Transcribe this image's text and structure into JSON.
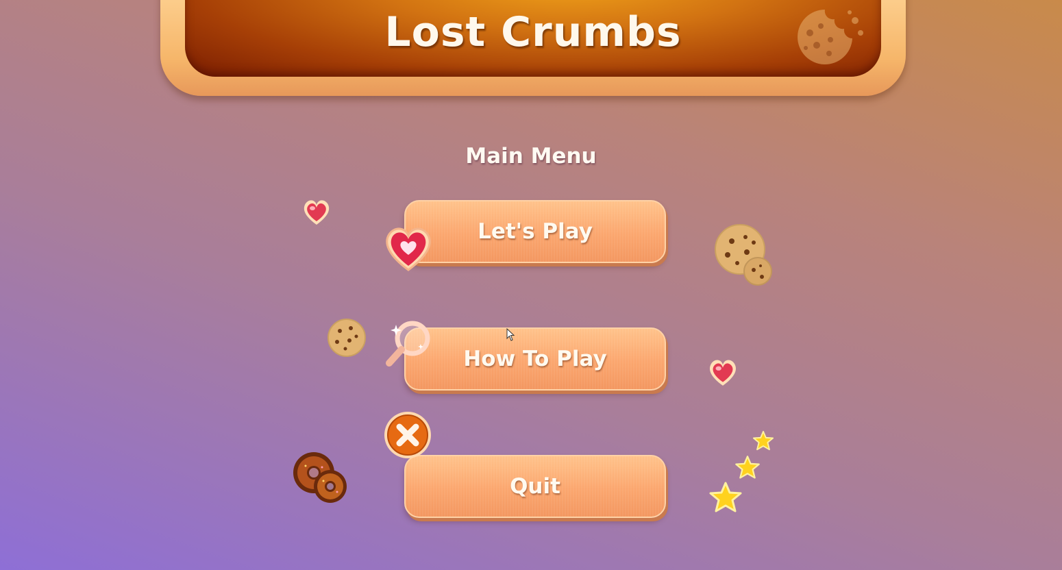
{
  "title": "Lost Crumbs",
  "menu": {
    "heading": "Main Menu",
    "buttons": [
      {
        "label": "Let's Play",
        "icon": "heart-icon"
      },
      {
        "label": "How To Play",
        "icon": "magnifier-icon"
      },
      {
        "label": "Quit",
        "icon": "close-icon"
      }
    ]
  },
  "decorations": [
    "cookie-icon",
    "heart-icon",
    "donut-icon",
    "star-icon"
  ],
  "colors": {
    "banner_dark": "#7a1d02",
    "banner_light": "#f0a21a",
    "button": "#fba66e",
    "text": "#fffaf2"
  }
}
